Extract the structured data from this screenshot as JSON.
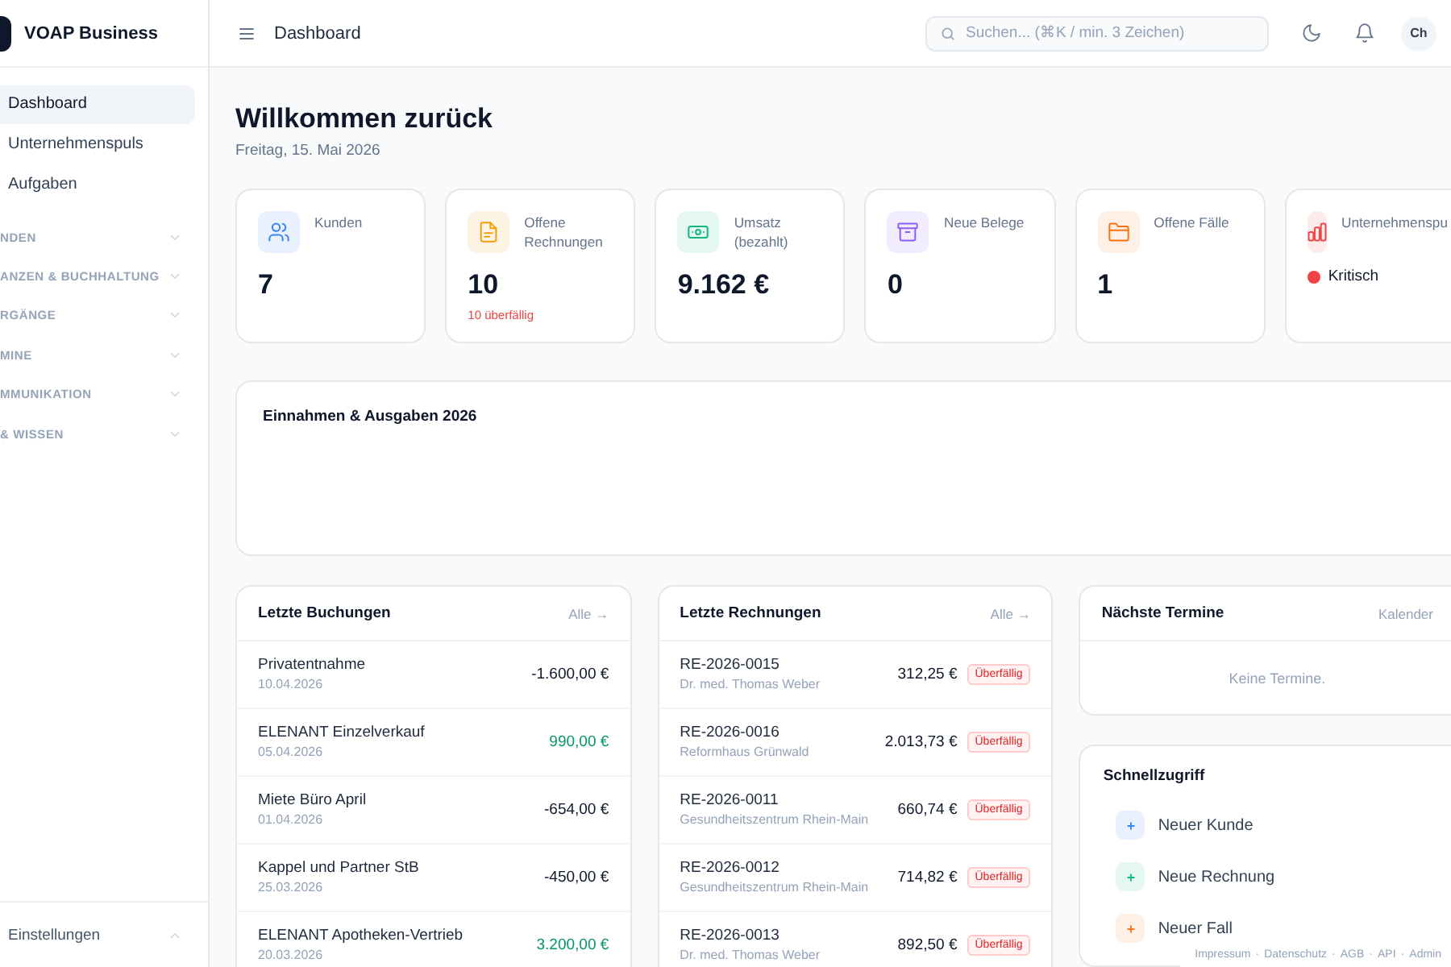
{
  "sidebar": {
    "brand": "VOAP Business",
    "items": [
      {
        "label": "Dashboard",
        "selected": true
      },
      {
        "label": "Unternehmenspuls",
        "selected": false
      },
      {
        "label": "Aufgaben",
        "selected": false
      }
    ],
    "sections": [
      {
        "label": "NDEN",
        "expanded": false
      },
      {
        "label": "ANZEN & BUCHHALTUNG",
        "expanded": false
      },
      {
        "label": "RGÄNGE",
        "expanded": false
      },
      {
        "label": "MINE",
        "expanded": false
      },
      {
        "label": "MMUNIKATION",
        "expanded": false
      },
      {
        "label": "& WISSEN",
        "expanded": false
      }
    ],
    "footer": {
      "label": "Einstellungen"
    }
  },
  "topbar": {
    "title": "Dashboard",
    "search": {
      "placeholder": "Suchen... (⌘K / min. 3 Zeichen)"
    },
    "avatar": "Ch"
  },
  "greeting": {
    "title": "Willkommen zurück",
    "date": "Freitag, 15. Mai 2026"
  },
  "kpis": [
    {
      "kind": "metric",
      "label": "Kunden",
      "value": "7",
      "color": "#3b82f6"
    },
    {
      "kind": "metric",
      "label": "Offene Rechnungen",
      "value": "10",
      "note": "10 überfällig",
      "color": "#f59e0b"
    },
    {
      "kind": "metric",
      "label": "Umsatz (bezahlt)",
      "value": "9.162 €",
      "color": "#10b981"
    },
    {
      "kind": "metric",
      "label": "Neue Belege",
      "value": "0",
      "color": "#8b5cf6"
    },
    {
      "kind": "metric",
      "label": "Offene Fälle",
      "value": "1",
      "color": "#f97316"
    },
    {
      "kind": "status",
      "label": "Unternehmenspu",
      "status": {
        "label": "Kritisch",
        "color": "#ef4444"
      },
      "color": "#ef4444"
    }
  ],
  "chart_card": {
    "title": "Einnahmen & Ausgaben 2026"
  },
  "bookings": {
    "title": "Letzte Buchungen",
    "link": "Alle →",
    "rows": [
      {
        "name": "Privatentnahme",
        "date": "10.04.2026",
        "amount": "-1.600,00 €",
        "kind": "expense"
      },
      {
        "name": "ELENANT Einzelverkauf",
        "date": "05.04.2026",
        "amount": "990,00 €",
        "kind": "income"
      },
      {
        "name": "Miete Büro April",
        "date": "01.04.2026",
        "amount": "-654,00 €",
        "kind": "expense"
      },
      {
        "name": "Kappel und Partner StB",
        "date": "25.03.2026",
        "amount": "-450,00 €",
        "kind": "expense"
      },
      {
        "name": "ELENANT Apotheken-Vertrieb",
        "date": "20.03.2026",
        "amount": "3.200,00 €",
        "kind": "income"
      }
    ]
  },
  "invoices": {
    "title": "Letzte Rechnungen",
    "link": "Alle →",
    "rows": [
      {
        "number": "RE-2026-0015",
        "customer": "Dr. med. Thomas Weber",
        "amount": "312,25 €",
        "status": "Überfällig"
      },
      {
        "number": "RE-2026-0016",
        "customer": "Reformhaus Grünwald",
        "amount": "2.013,73 €",
        "status": "Überfällig"
      },
      {
        "number": "RE-2026-0011",
        "customer": "Gesundheitszentrum Rhein-Main",
        "amount": "660,74 €",
        "status": "Überfällig"
      },
      {
        "number": "RE-2026-0012",
        "customer": "Gesundheitszentrum Rhein-Main",
        "amount": "714,82 €",
        "status": "Überfällig"
      },
      {
        "number": "RE-2026-0013",
        "customer": "Dr. med. Thomas Weber",
        "amount": "892,50 €",
        "status": "Überfällig"
      }
    ]
  },
  "appointments": {
    "title": "Nächste Termine",
    "link": "Kalender",
    "empty": "Keine Termine."
  },
  "quick_access": {
    "title": "Schnellzugriff",
    "items": [
      {
        "label": "Neuer Kunde",
        "color": "#3b82f6"
      },
      {
        "label": "Neue Rechnung",
        "color": "#10b981"
      },
      {
        "label": "Neuer Fall",
        "color": "#f97316"
      }
    ]
  },
  "footer": {
    "links": [
      "Impressum",
      "Datenschutz",
      "AGB",
      "API",
      "Admin"
    ],
    "separator": "·"
  }
}
